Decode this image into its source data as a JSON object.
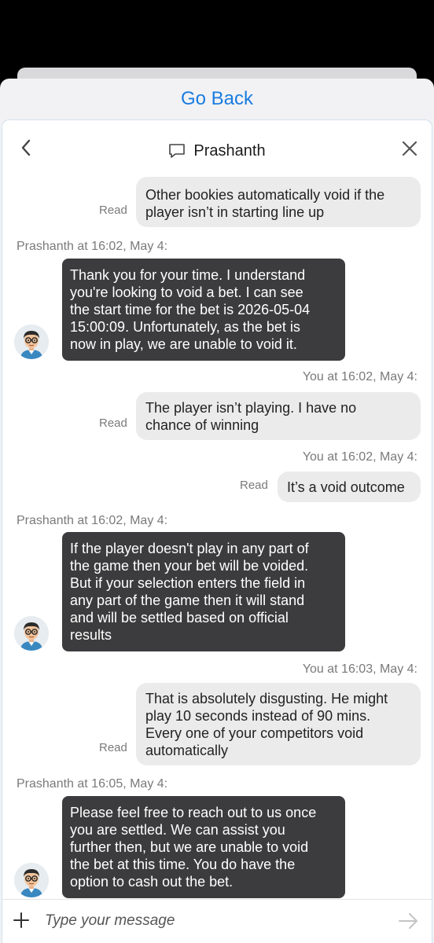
{
  "sheet": {
    "go_back_label": "Go Back"
  },
  "chat": {
    "title": "Prashanth",
    "input_placeholder": "Type your message"
  },
  "messages": [
    {
      "from": "you",
      "lines": [
        "Other bookies automatically void if the",
        "player isn’t in starting line up"
      ],
      "status": "Read"
    },
    {
      "from": "agent",
      "meta": "Prashanth at 16:02, May 4:",
      "lines": [
        "Thank you for your time. I understand",
        "you're looking to void a bet. I can see",
        "the start time for the bet is 2026-05-04",
        "15:00:09. Unfortunately, as the bet is",
        "now in play, we are unable to void it."
      ]
    },
    {
      "from": "you",
      "meta": "You at 16:02, May 4:",
      "lines": [
        "The player isn’t playing. I have no",
        "chance of winning"
      ],
      "status": "Read"
    },
    {
      "from": "you",
      "meta": "You at 16:02, May 4:",
      "lines": [
        "It’s a void outcome"
      ],
      "status": "Read"
    },
    {
      "from": "agent",
      "meta": "Prashanth at 16:02, May 4:",
      "lines": [
        "If the player doesn't play in any part of",
        "the game then your bet will be voided.",
        "But if your selection enters the field in",
        "any part of the game then it will stand",
        "and will be settled based on official",
        "results"
      ]
    },
    {
      "from": "you",
      "meta": "You at 16:03, May 4:",
      "lines": [
        "That is absolutely disgusting. He might",
        "play 10 seconds instead of 90 mins.",
        "Every one of your competitors void",
        "automatically"
      ],
      "status": "Read"
    },
    {
      "from": "agent",
      "meta": "Prashanth at 16:05, May 4:",
      "lines": [
        "Please feel free to reach out to us once",
        "you are settled. We can assist you",
        "further then, but we are unable to void",
        "the bet at this time. You do have the",
        "option to cash out the bet."
      ]
    }
  ],
  "colors": {
    "link_blue": "#1a7ce0",
    "agent_bubble": "#3c3c3e",
    "user_bubble": "#ebebeb",
    "meta_text": "#7a7a7a"
  },
  "icons": {
    "back": "chevron-left-icon",
    "close": "close-icon",
    "title": "chat-bubble-icon",
    "add": "plus-icon",
    "send": "send-arrow-icon",
    "avatar": "agent-avatar"
  }
}
